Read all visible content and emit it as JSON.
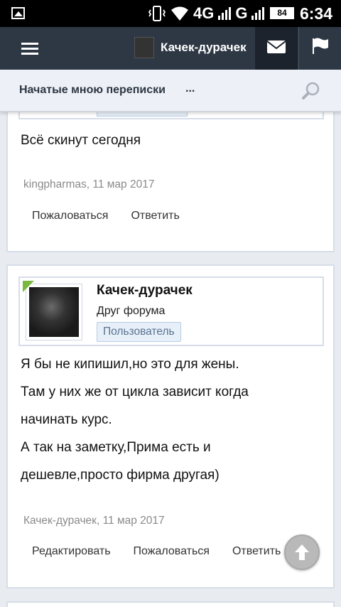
{
  "status_bar": {
    "network": "4G",
    "network2": "G",
    "battery": "84",
    "time": "6:34"
  },
  "header": {
    "title": "Качек-дурачек"
  },
  "subheader": {
    "link": "Начатые мною переписки",
    "more": "..."
  },
  "posts": [
    {
      "message_lines": [
        "Всё скинут сегодня"
      ],
      "author_link": "kingpharmas",
      "date": ", 11 мар 2017",
      "actions": [
        "Пожаловаться",
        "Ответить"
      ]
    },
    {
      "username": "Качек-дурачек",
      "user_title": "Друг форума",
      "badge": "Пользователь",
      "message_lines": [
        "Я бы не кипишил,но это для жены.",
        "Там у них же от цикла зависит когда",
        "начинать курс.",
        "А так на заметку,Прима есть и",
        "дешевле,просто фирма другая)"
      ],
      "author_link": "Качек-дурачек",
      "date": ", 11 мар 2017",
      "actions": [
        "Редактировать",
        "Пожаловаться",
        "Ответить"
      ]
    }
  ]
}
